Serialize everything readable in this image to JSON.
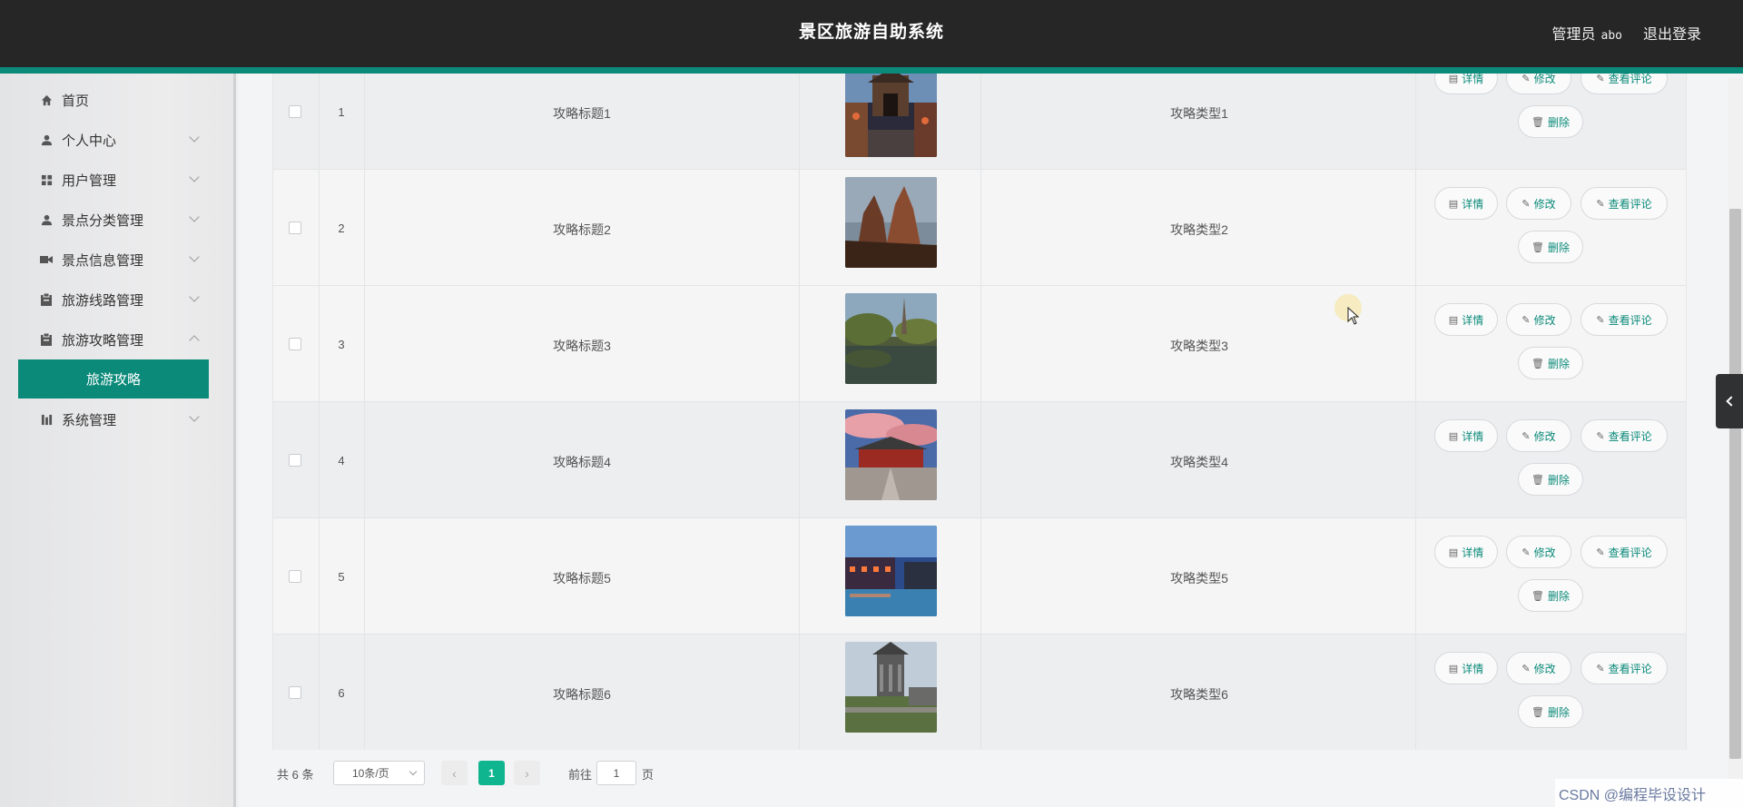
{
  "header": {
    "title": "景区旅游自助系统",
    "user_role": "管理员",
    "username": "abo",
    "logout_label": "退出登录"
  },
  "sidebar": {
    "items": [
      {
        "label": "首页",
        "icon": "home-icon"
      },
      {
        "label": "个人中心",
        "icon": "user-icon"
      },
      {
        "label": "用户管理",
        "icon": "grid-icon"
      },
      {
        "label": "景点分类管理",
        "icon": "user-icon"
      },
      {
        "label": "景点信息管理",
        "icon": "video-icon"
      },
      {
        "label": "旅游线路管理",
        "icon": "clipboard-icon"
      },
      {
        "label": "旅游攻略管理",
        "icon": "clipboard-icon"
      },
      {
        "label": "系统管理",
        "icon": "chart-icon"
      }
    ],
    "active_sub": "旅游攻略"
  },
  "table": {
    "actions": {
      "detail": "详情",
      "edit": "修改",
      "comments": "查看评论",
      "delete": "删除"
    },
    "rows": [
      {
        "index": "1",
        "title": "攻略标题1",
        "type": "攻略类型1"
      },
      {
        "index": "2",
        "title": "攻略标题2",
        "type": "攻略类型2"
      },
      {
        "index": "3",
        "title": "攻略标题3",
        "type": "攻略类型3"
      },
      {
        "index": "4",
        "title": "攻略标题4",
        "type": "攻略类型4"
      },
      {
        "index": "5",
        "title": "攻略标题5",
        "type": "攻略类型5"
      },
      {
        "index": "6",
        "title": "攻略标题6",
        "type": "攻略类型6"
      }
    ]
  },
  "pagination": {
    "total": "共 6 条",
    "page_size": "10条/页",
    "current_page": "1",
    "goto_label": "前往",
    "goto_value": "1",
    "page_unit": "页"
  },
  "watermark": {
    "text": "CSDN @编程毕设设计"
  }
}
